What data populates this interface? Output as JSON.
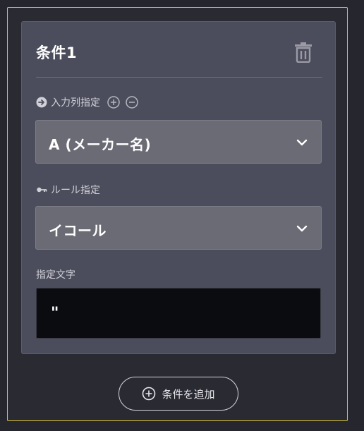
{
  "condition": {
    "title": "条件1",
    "input_column": {
      "label": "入力列指定",
      "value": "A (メーカー名)"
    },
    "rule": {
      "label": "ルール指定",
      "value": "イコール"
    },
    "text": {
      "label": "指定文字",
      "value": "\""
    }
  },
  "add_button": {
    "label": "条件を追加"
  },
  "colors": {
    "frame_border": "#d4c23a",
    "card_bg": "#4c4d5c",
    "select_bg": "#6b6b76",
    "input_bg": "#0b0c10"
  },
  "icons": {
    "delete": "trash-icon",
    "input_column": "arrow-right-circle-icon",
    "add_column": "plus-circle-icon",
    "remove_column": "minus-circle-icon",
    "rule": "key-icon",
    "dropdown": "chevron-down-icon",
    "add_condition": "plus-circle-icon"
  }
}
